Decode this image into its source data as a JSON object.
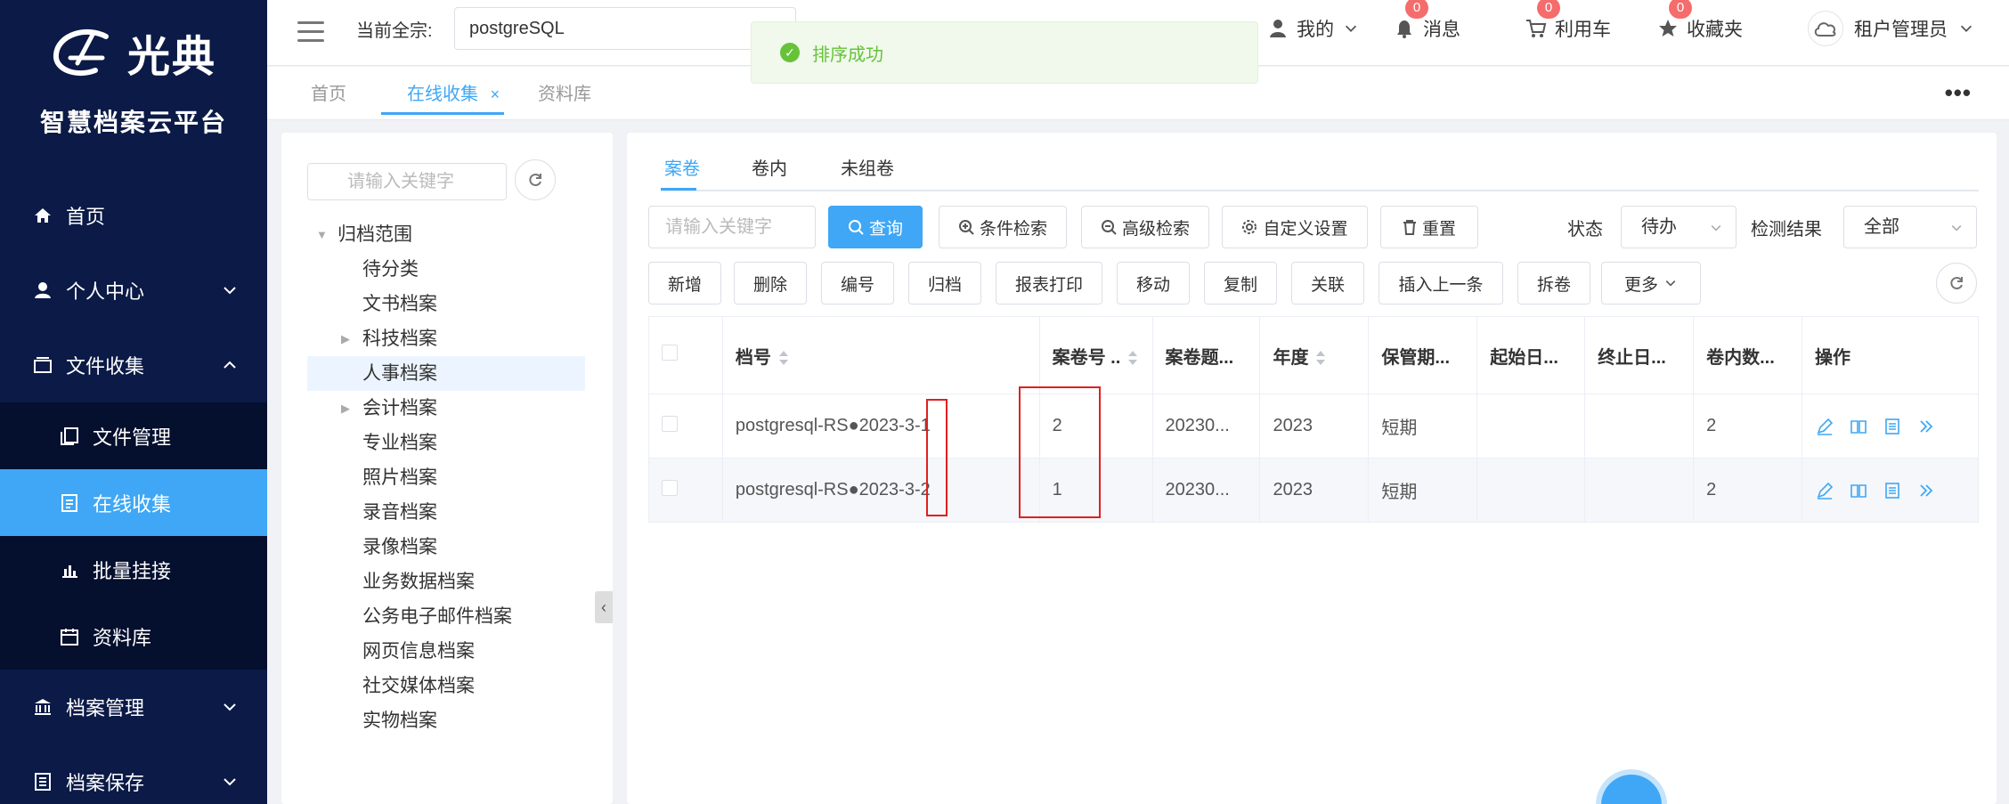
{
  "brand": {
    "logo_text": "光典",
    "subtitle": "智慧档案云平台"
  },
  "sidebar": {
    "items": [
      {
        "label": "首页",
        "icon": "home-icon"
      },
      {
        "label": "个人中心",
        "icon": "user-icon"
      },
      {
        "label": "文件收集",
        "icon": "folder-icon"
      },
      {
        "label": "档案管理",
        "icon": "bank-icon"
      },
      {
        "label": "档案保存",
        "icon": "building-icon"
      }
    ],
    "submenu": [
      {
        "label": "文件管理",
        "icon": "files-icon"
      },
      {
        "label": "在线收集",
        "icon": "document-icon",
        "active": true
      },
      {
        "label": "批量挂接",
        "icon": "bar-chart-icon"
      },
      {
        "label": "资料库",
        "icon": "calendar-icon"
      }
    ]
  },
  "header": {
    "scope_label": "当前全宗:",
    "scope_value": "postgreSQL",
    "toast": "排序成功",
    "mine": "我的",
    "messages": {
      "label": "消息",
      "count": "0"
    },
    "cart": {
      "label": "利用车",
      "count": "0"
    },
    "favorites": {
      "label": "收藏夹",
      "count": "0"
    },
    "user": "租户管理员"
  },
  "tabs": [
    {
      "label": "首页"
    },
    {
      "label": "在线收集",
      "close": "×"
    },
    {
      "label": "资料库"
    }
  ],
  "tree": {
    "search_placeholder": "请输入关键字",
    "root": "归档范围",
    "nodes": [
      "待分类",
      "文书档案",
      "科技档案",
      "人事档案",
      "会计档案",
      "专业档案",
      "照片档案",
      "录音档案",
      "录像档案",
      "业务数据档案",
      "公务电子邮件档案",
      "网页信息档案",
      "社交媒体档案",
      "实物档案"
    ]
  },
  "main": {
    "subtabs": [
      "案卷",
      "卷内",
      "未组卷"
    ],
    "keyword_placeholder": "请输入关键字",
    "buttons_row1": {
      "query": "查询",
      "condition": "条件检索",
      "advanced": "高级检索",
      "custom": "自定义设置",
      "reset": "重置"
    },
    "status_label": "状态",
    "status_value": "待办",
    "check_label": "检测结果",
    "check_value": "全部",
    "buttons_row2": [
      "新增",
      "删除",
      "编号",
      "归档",
      "报表打印",
      "移动",
      "复制",
      "关联",
      "插入上一条",
      "拆卷",
      "更多"
    ],
    "columns": [
      "档号",
      "案卷号 ..",
      "案卷题...",
      "年度",
      "保管期...",
      "起始日...",
      "终止日...",
      "卷内数...",
      "操作"
    ],
    "rows": [
      {
        "danghao": "postgresql-RS●2023-3-1",
        "anjuanhao": "2",
        "title": "20230...",
        "year": "2023",
        "period": "短期",
        "start": "",
        "end": "",
        "count": "2"
      },
      {
        "danghao": "postgresql-RS●2023-3-2",
        "anjuanhao": "1",
        "title": "20230...",
        "year": "2023",
        "period": "短期",
        "start": "",
        "end": "",
        "count": "2"
      }
    ]
  }
}
